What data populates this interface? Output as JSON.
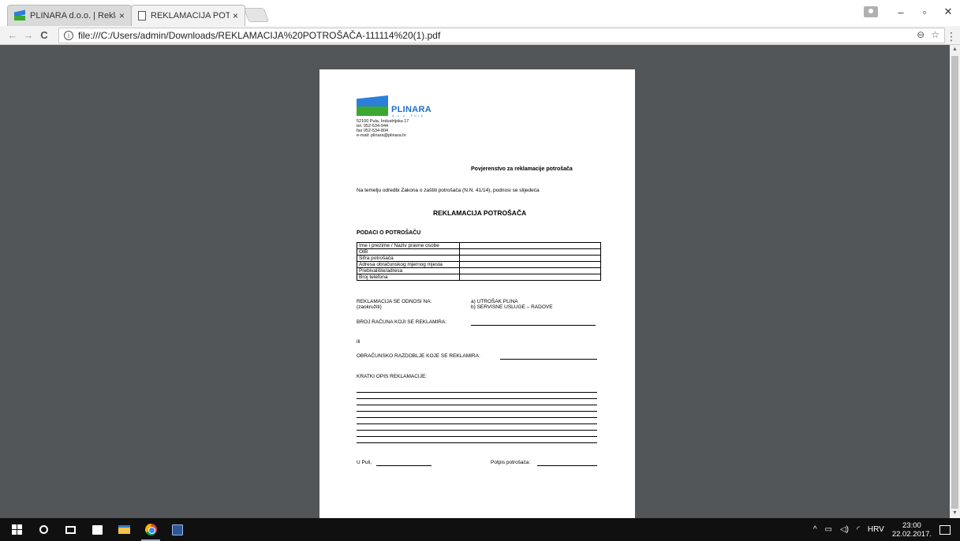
{
  "tabs": [
    {
      "title": "PLINARA d.o.o. | Reklam",
      "close": "×"
    },
    {
      "title": "REKLAMACIJA POTROŠA",
      "close": "×"
    }
  ],
  "window_controls": {
    "minimize": "–",
    "maximize": "▫",
    "close": "✕"
  },
  "nav": {
    "back": "←",
    "forward": "→",
    "reload": "C"
  },
  "address": {
    "info": "i",
    "url": "file:///C:/Users/admin/Downloads/REKLAMACIJA%20POTROŠAČA-111114%20(1).pdf",
    "zoom": "⊖",
    "star": "☆",
    "menu": "⋮"
  },
  "doc": {
    "brand": "PLINARA",
    "brand_sub": "d.o.o. PULA",
    "address_lines": [
      "52100 Pula, Industrijska 17",
      "tel. 052-534-944",
      "fax 052-534-804",
      "e-mail: plinara@plinara.hr"
    ],
    "recipient": "Povjerenstvo za reklamacije potrošača",
    "intro": "Na temelju odredbi Zakona o zaštiti potrošača (N.N. 41/14), podnosi se slijedeća",
    "title": "REKLAMACIJA POTROŠAČA",
    "section": "PODACI O POTROŠAČU",
    "fields": [
      "Ime i prezime / Naziv pravne osobe",
      "OIB",
      "Šifra potrošača",
      "Adresa obračunskog mjernog mjesta",
      "Prebivalište/adresa",
      "Broj telefona"
    ],
    "refers_label": "REKLAMACIJA SE ODNOSI NA:",
    "refers_hint": "(zaokružiti)",
    "option_a": "a) UTROŠAK PLINA",
    "option_b": "b) SERVISNE USLUGE – RADOVE",
    "invoice_label": "BROJ RAČUNA KOJI SE REKLAMIRA:",
    "or": "ili",
    "period_label": "OBRAČUNSKO RAZDOBLJE KOJE SE REKLAMIRA:",
    "desc_label": "KRATKI OPIS REKLAMACIJE:",
    "place_label": "U Puli,",
    "signature_label": "Potpis potrošača:"
  },
  "tray": {
    "chevron": "^",
    "lang": "HRV",
    "time": "23:00",
    "date": "22.02.2017."
  }
}
